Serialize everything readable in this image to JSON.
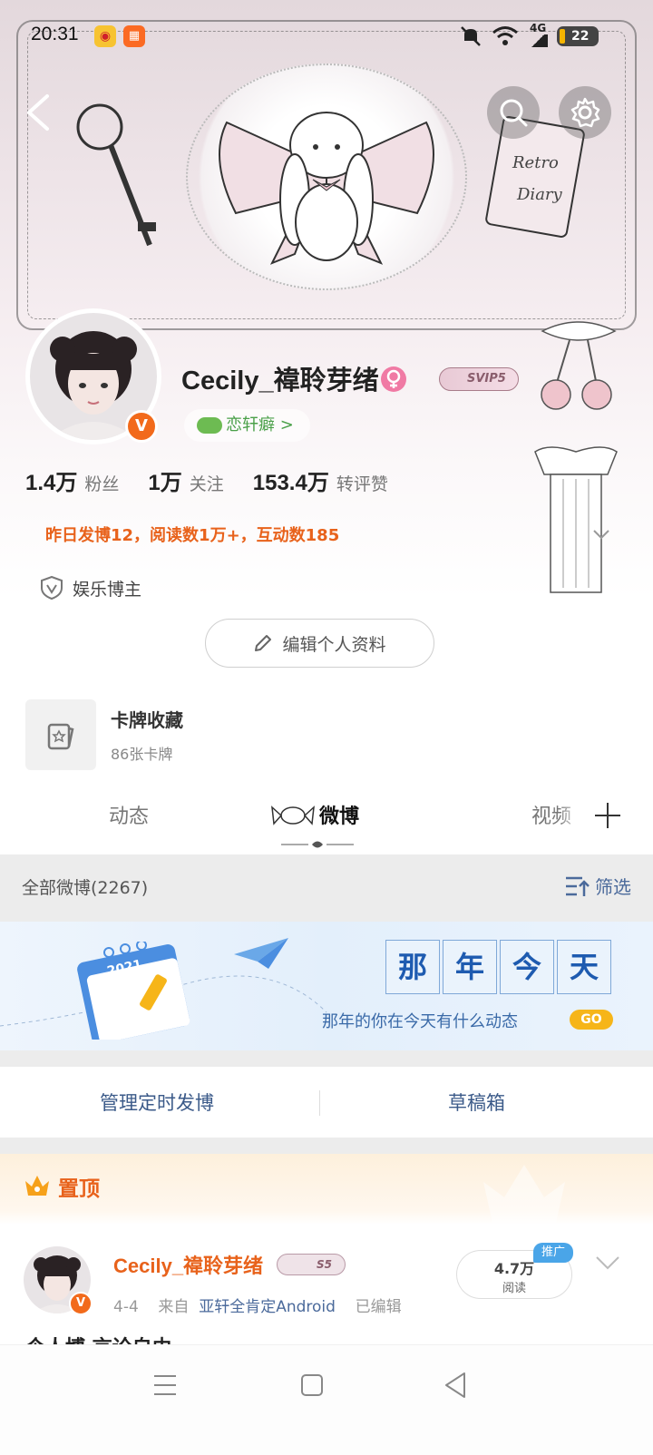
{
  "status_bar": {
    "time": "20:31",
    "net": "4G",
    "battery": "22"
  },
  "profile": {
    "username": "Cecily_禕聆芽绪",
    "svip": "SVIP5",
    "verified_badge": "V",
    "fan_tag": "恋轩癖 >",
    "stats": [
      {
        "num": "1.4万",
        "label": "粉丝"
      },
      {
        "num": "1万",
        "label": "关注"
      },
      {
        "num": "153.4万",
        "label": "转评赞"
      }
    ],
    "yesterday": "昨日发博12，阅读数1万+，互动数185",
    "category": "娱乐博主",
    "edit_button": "编辑个人资料"
  },
  "card_collection": {
    "title": "卡牌收藏",
    "count": "86张卡牌"
  },
  "tabs": [
    {
      "label": "动态"
    },
    {
      "label": "微博"
    },
    {
      "label": "视频"
    }
  ],
  "all_weibo": {
    "label": "全部微博(2267)",
    "filter": "筛选"
  },
  "memory_banner": {
    "year": "2021",
    "chars": [
      "那",
      "年",
      "今",
      "天"
    ],
    "subtitle": "那年的你在今天有什么动态",
    "go": "GO"
  },
  "manage": {
    "scheduled": "管理定时发博",
    "drafts": "草稿箱"
  },
  "pinned": {
    "label": "置顶"
  },
  "post": {
    "name": "Cecily_禕聆芽绪",
    "badge": "S5",
    "date": "4-4",
    "from": "来自",
    "source": "亚轩全肯定Android",
    "edited": "已编辑",
    "reads": "4.7万",
    "reads_label": "阅读",
    "promo": "推广",
    "text": "个人博 言论自由"
  },
  "colors": {
    "accent_orange": "#e8621b",
    "link_blue": "#4b6a9b",
    "bg_gray": "#ececec"
  }
}
